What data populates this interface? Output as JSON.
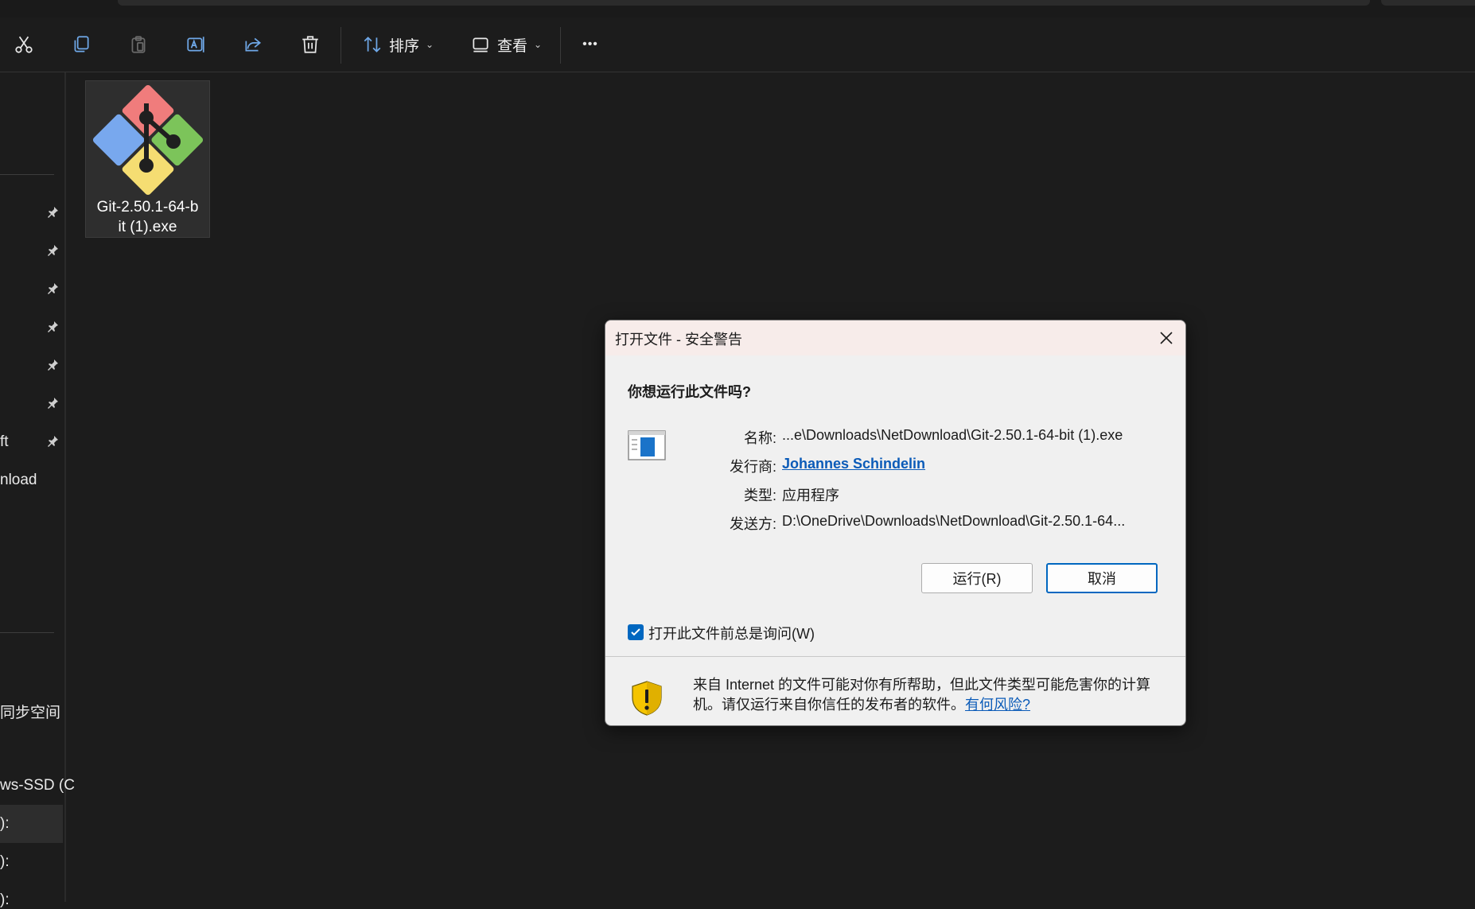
{
  "toolbar": {
    "buttons": [
      {
        "name": "cut",
        "icon": "scissors-icon"
      },
      {
        "name": "copy",
        "icon": "copy-icon"
      },
      {
        "name": "paste",
        "icon": "clipboard-icon"
      },
      {
        "name": "rename",
        "icon": "rename-icon"
      },
      {
        "name": "share",
        "icon": "share-icon"
      },
      {
        "name": "delete",
        "icon": "trash-icon"
      }
    ],
    "sort_label": "排序",
    "view_label": "查看",
    "more_label": "•••"
  },
  "sidebar": {
    "labels": [
      "ft",
      "nload",
      "同步空间",
      "ws-SSD (C",
      "):",
      "):",
      "):"
    ]
  },
  "file": {
    "name": "Git-2.50.1-64-bit (1).exe",
    "name_line1": "Git-2.50.1-64-b",
    "name_line2": "it (1).exe"
  },
  "dialog": {
    "title": "打开文件 - 安全警告",
    "question": "你想运行此文件吗?",
    "fields": {
      "name_label": "名称:",
      "name_value": "...e\\Downloads\\NetDownload\\Git-2.50.1-64-bit (1).exe",
      "publisher_label": "发行商:",
      "publisher_value": "Johannes Schindelin",
      "type_label": "类型:",
      "type_value": "应用程序",
      "from_label": "发送方:",
      "from_value": "D:\\OneDrive\\Downloads\\NetDownload\\Git-2.50.1-64..."
    },
    "run_button": "运行(R)",
    "cancel_button": "取消",
    "checkbox_label": "打开此文件前总是询问(W)",
    "checkbox_checked": true,
    "warning_text": "来自 Internet 的文件可能对你有所帮助，但此文件类型可能危害你的计算机。请仅运行来自你信任的发布者的软件。",
    "warning_link": "有何风险?"
  },
  "colors": {
    "background": "#1c1c1c",
    "dialog_bg": "#f0f0f0",
    "accent": "#0067c0",
    "link": "#0b5bb8"
  }
}
